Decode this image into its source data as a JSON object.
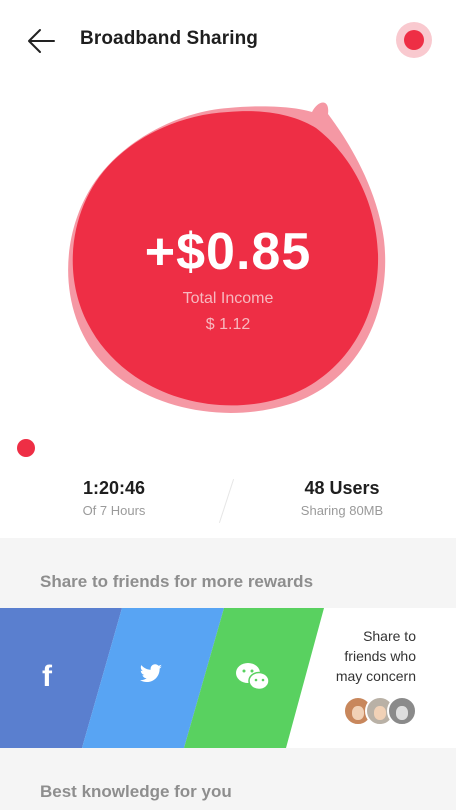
{
  "header": {
    "title": "Broadband Sharing",
    "back_icon": "arrow-left-icon",
    "status_icon": "record-dot-icon"
  },
  "income": {
    "value": "+$0.85",
    "label": "Total Income",
    "sub": "$ 1.12"
  },
  "stats": {
    "time_value": "1:20:46",
    "time_sub": "Of 7 Hours",
    "users_value": "48 Users",
    "users_sub": "Sharing 80MB"
  },
  "share": {
    "title": "Share to friends for more rewards",
    "facebook_icon": "facebook-icon",
    "twitter_icon": "twitter-icon",
    "wechat_icon": "wechat-icon",
    "note_line1": "Share to",
    "note_line2": "friends who",
    "note_line3": "may concern"
  },
  "knowledge": {
    "title": "Best knowledge for you"
  },
  "colors": {
    "accent": "#ee2e45",
    "facebook": "#5a7fcf",
    "twitter": "#58a4f3",
    "wechat": "#59d160"
  }
}
